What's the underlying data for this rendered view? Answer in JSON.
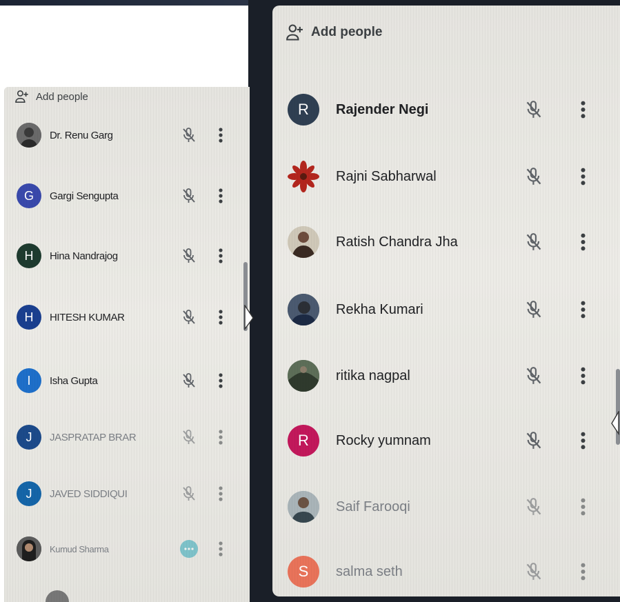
{
  "left_panel": {
    "add_people_label": "Add people",
    "participants": [
      {
        "name": "Dr. Renu Garg",
        "initial": "",
        "avatar_color": "#5a5a5a",
        "photo": true
      },
      {
        "name": "Gargi Sengupta",
        "initial": "G",
        "avatar_color": "#3949ab"
      },
      {
        "name": "Hina Nandrajog",
        "initial": "H",
        "avatar_color": "#1e3b2f"
      },
      {
        "name": "HITESH KUMAR",
        "initial": "H",
        "avatar_color": "#1a3f8f"
      },
      {
        "name": "Isha Gupta",
        "initial": "I",
        "avatar_color": "#1e6fc9"
      },
      {
        "name": "JASPRATAP BRAR",
        "initial": "J",
        "avatar_color": "#1c4a8a"
      },
      {
        "name": "JAVED SIDDIQUI",
        "initial": "J",
        "avatar_color": "#1565a8"
      },
      {
        "name": "Kumud Sharma",
        "initial": "",
        "avatar_color": "#3a3a3a",
        "photo": true
      }
    ]
  },
  "right_panel": {
    "add_people_label": "Add people",
    "participants": [
      {
        "name": "Rajender Negi",
        "initial": "R",
        "avatar_color": "#2f3f52"
      },
      {
        "name": "Rajni Sabharwal",
        "initial": "",
        "avatar_color": "#b3261e",
        "photo": true
      },
      {
        "name": "Ratish Chandra Jha",
        "initial": "",
        "avatar_color": "#6d4c3d",
        "photo": true
      },
      {
        "name": "Rekha Kumari",
        "initial": "",
        "avatar_color": "#3d4a5c",
        "photo": true
      },
      {
        "name": "ritika nagpal",
        "initial": "",
        "avatar_color": "#4a5a48",
        "photo": true
      },
      {
        "name": "Rocky yumnam",
        "initial": "R",
        "avatar_color": "#c2185b"
      },
      {
        "name": "Saif Farooqi",
        "initial": "",
        "avatar_color": "#546e7a",
        "photo": true
      },
      {
        "name": "salma seth",
        "initial": "S",
        "avatar_color": "#e8735a"
      }
    ]
  },
  "icons": {
    "add_person": "person-add-icon",
    "mic_off": "mic-off-icon",
    "more": "more-vert-icon",
    "speaking": "speaking-indicator-icon"
  }
}
